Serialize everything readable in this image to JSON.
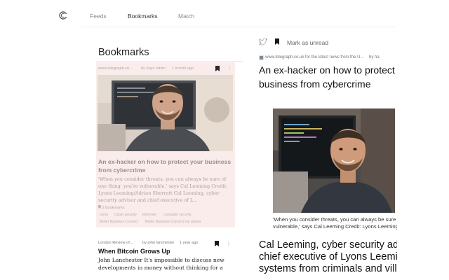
{
  "nav": {
    "tabs": [
      {
        "label": "Feeds"
      },
      {
        "label": "Bookmarks"
      },
      {
        "label": "Match"
      }
    ],
    "active_tab": "Bookmarks"
  },
  "bookmarks": {
    "heading": "Bookmarks",
    "items": [
      {
        "source": "www.telegraph.co...",
        "author": "by hays rahim",
        "time": "1 month ago",
        "title": "An ex-hacker on how to protect your business from cybercrime",
        "excerpt": "'When you consider threats, you can always be sure of one thing: you're vulnerable,' says Cal Leeming Credit: Lyons Leeming/Adrian Sherratt Cal Leeming, cyber security advisor and chief executive of L...",
        "bookmark_count": "2 bookmarks",
        "tags": [
          "crime",
          "Cyber security",
          "Interview",
          "computer security",
          "Better Business Connect",
          "Better Business Connect top stories"
        ]
      },
      {
        "source": "London Review of...",
        "author": "by john lanchester",
        "time": "1 year ago",
        "title": "When Bitcoin Grows Up",
        "excerpt": "John Lanchester It's impossible to discuss new developments in money without thinking for a"
      }
    ]
  },
  "reader": {
    "mark_unread": "Mark as unread",
    "source": "www.telegraph.co.uk for the latest news from the U...",
    "author": "by ha",
    "title": "An ex-hacker on how to protect your business from cybercrime",
    "caption": "'When you consider threats, you can always be sure of one thing: you're vulnerable,' says Cal Leeming Credit: Lyons Leeming/Adrian Sherratt",
    "lede": "Cal Leeming, cyber security advisor and chief executive of Lyons Leeming, defends systems from criminals and villains"
  },
  "icons": {
    "logo": "app-logo",
    "bookmark": "bookmark-icon",
    "more": "more-vertical-icon",
    "twitter": "twitter-icon"
  },
  "colors": {
    "active_card_bg": "#fbecec",
    "bookmark_dark": "#222222",
    "nav_text": "#888888"
  }
}
